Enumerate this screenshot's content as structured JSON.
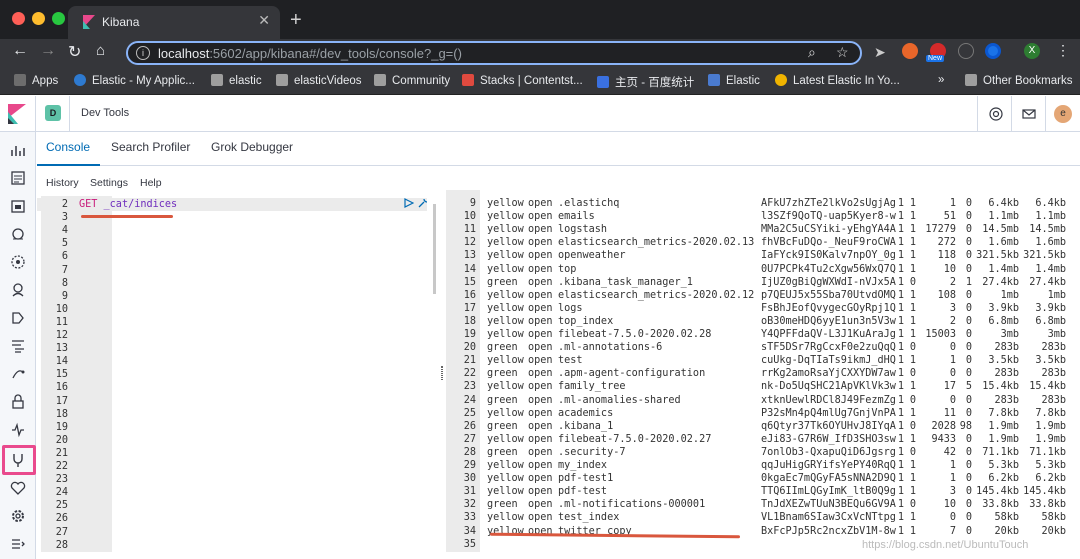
{
  "browser": {
    "tab_title": "Kibana",
    "url_host": "localhost",
    "url_rest": ":5602/app/kibana#/dev_tools/console?_g=()",
    "new_badge": "New",
    "account_initial": "X",
    "bookmarks": [
      {
        "label": "Apps",
        "color": "#6d6d6d"
      },
      {
        "label": "Elastic - My Applic...",
        "color": "#2e7ad0"
      },
      {
        "label": "elastic",
        "color": "#9e9e9e"
      },
      {
        "label": "elasticVideos",
        "color": "#9e9e9e"
      },
      {
        "label": "Community",
        "color": "#9e9e9e"
      },
      {
        "label": "Stacks | Contentst...",
        "color": "#e04a3f"
      },
      {
        "label": "主页 - 百度统计",
        "color": "#3a70e0"
      },
      {
        "label": "Elastic",
        "color": "#4a7bd0"
      },
      {
        "label": "Latest Elastic In Yo...",
        "color": "#f0b400"
      }
    ],
    "more_bookmarks": "»",
    "other_bookmarks": "Other Bookmarks"
  },
  "header": {
    "space_initial": "D",
    "breadcrumb": "Dev Tools",
    "user_initial": "e"
  },
  "tabs": [
    "Console",
    "Search Profiler",
    "Grok Debugger"
  ],
  "menu": [
    "History",
    "Settings",
    "Help"
  ],
  "editor": {
    "lines": [
      {
        "num": "2",
        "method": "GET",
        "path": " _cat/indices"
      },
      {
        "num": "3",
        "method": "",
        "path": ""
      },
      {
        "num": "4",
        "method": "",
        "path": ""
      },
      {
        "num": "5",
        "method": "",
        "path": ""
      },
      {
        "num": "6",
        "method": "",
        "path": ""
      },
      {
        "num": "7",
        "method": "",
        "path": ""
      },
      {
        "num": "8",
        "method": "",
        "path": ""
      },
      {
        "num": "9",
        "method": "",
        "path": ""
      },
      {
        "num": "10",
        "method": "",
        "path": ""
      },
      {
        "num": "11",
        "method": "",
        "path": ""
      },
      {
        "num": "12",
        "method": "",
        "path": ""
      },
      {
        "num": "13",
        "method": "",
        "path": ""
      },
      {
        "num": "14",
        "method": "",
        "path": ""
      },
      {
        "num": "15",
        "method": "",
        "path": ""
      },
      {
        "num": "16",
        "method": "",
        "path": ""
      },
      {
        "num": "17",
        "method": "",
        "path": ""
      },
      {
        "num": "18",
        "method": "",
        "path": ""
      },
      {
        "num": "19",
        "method": "",
        "path": ""
      },
      {
        "num": "20",
        "method": "",
        "path": ""
      },
      {
        "num": "21",
        "method": "",
        "path": ""
      },
      {
        "num": "22",
        "method": "",
        "path": ""
      },
      {
        "num": "23",
        "method": "",
        "path": ""
      },
      {
        "num": "24",
        "method": "",
        "path": ""
      },
      {
        "num": "25",
        "method": "",
        "path": ""
      },
      {
        "num": "26",
        "method": "",
        "path": ""
      },
      {
        "num": "27",
        "method": "",
        "path": ""
      },
      {
        "num": "28",
        "method": "",
        "path": ""
      }
    ]
  },
  "output": {
    "rows": [
      {
        "num": "9",
        "health": "yellow",
        "status": "open",
        "index": ".elastichq",
        "uuid": "AFkU7zhZTe2lkVo2sUgjAg",
        "pri": "1",
        "rep": "1",
        "docs": "1",
        "del": "0",
        "size": "6.4kb",
        "psize": "6.4kb"
      },
      {
        "num": "10",
        "health": "yellow",
        "status": "open",
        "index": "emails",
        "uuid": "l3SZf9QoTQ-uap5Kyer8-w",
        "pri": "1",
        "rep": "1",
        "docs": "51",
        "del": "0",
        "size": "1.1mb",
        "psize": "1.1mb"
      },
      {
        "num": "11",
        "health": "yellow",
        "status": "open",
        "index": "logstash",
        "uuid": "MMa2C5uCSYiki-yEhgYA4A",
        "pri": "1",
        "rep": "1",
        "docs": "17279",
        "del": "0",
        "size": "14.5mb",
        "psize": "14.5mb"
      },
      {
        "num": "12",
        "health": "yellow",
        "status": "open",
        "index": "elasticsearch_metrics-2020.02.13",
        "uuid": "fhVBcFuDQo-_NeuF9roCWA",
        "pri": "1",
        "rep": "1",
        "docs": "272",
        "del": "0",
        "size": "1.6mb",
        "psize": "1.6mb"
      },
      {
        "num": "13",
        "health": "yellow",
        "status": "open",
        "index": "openweather",
        "uuid": "IaFYck9IS0Kalv7npOY_0g",
        "pri": "1",
        "rep": "1",
        "docs": "118",
        "del": "0",
        "size": "321.5kb",
        "psize": "321.5kb"
      },
      {
        "num": "14",
        "health": "yellow",
        "status": "open",
        "index": "top",
        "uuid": "0U7PCPk4Tu2cXgw56WxQ7Q",
        "pri": "1",
        "rep": "1",
        "docs": "10",
        "del": "0",
        "size": "1.4mb",
        "psize": "1.4mb"
      },
      {
        "num": "15",
        "health": "green",
        "status": "open",
        "index": ".kibana_task_manager_1",
        "uuid": "IjUZ0gBiQgWXWdI-nVJx5A",
        "pri": "1",
        "rep": "0",
        "docs": "2",
        "del": "1",
        "size": "27.4kb",
        "psize": "27.4kb"
      },
      {
        "num": "16",
        "health": "yellow",
        "status": "open",
        "index": "elasticsearch_metrics-2020.02.12",
        "uuid": "p7QEUJ5x55Sba70UtvdOMQ",
        "pri": "1",
        "rep": "1",
        "docs": "108",
        "del": "0",
        "size": "1mb",
        "psize": "1mb"
      },
      {
        "num": "17",
        "health": "yellow",
        "status": "open",
        "index": "logs",
        "uuid": "FsBhJEofQvygecGOyRpj1Q",
        "pri": "1",
        "rep": "1",
        "docs": "3",
        "del": "0",
        "size": "3.9kb",
        "psize": "3.9kb"
      },
      {
        "num": "18",
        "health": "yellow",
        "status": "open",
        "index": "top_index",
        "uuid": "oB30meHDQ6yyE1un3n5V3w",
        "pri": "1",
        "rep": "1",
        "docs": "2",
        "del": "0",
        "size": "6.8mb",
        "psize": "6.8mb"
      },
      {
        "num": "19",
        "health": "yellow",
        "status": "open",
        "index": "filebeat-7.5.0-2020.02.28",
        "uuid": "Y4QPFFdaQV-L3J1KuAraJg",
        "pri": "1",
        "rep": "1",
        "docs": "15003",
        "del": "0",
        "size": "3mb",
        "psize": "3mb"
      },
      {
        "num": "20",
        "health": "green",
        "status": "open",
        "index": ".ml-annotations-6",
        "uuid": "sTF5DSr7RgCcxF0e2zuQqQ",
        "pri": "1",
        "rep": "0",
        "docs": "0",
        "del": "0",
        "size": "283b",
        "psize": "283b"
      },
      {
        "num": "21",
        "health": "yellow",
        "status": "open",
        "index": "test",
        "uuid": "cuUkg-DqTIaTs9ikmJ_dHQ",
        "pri": "1",
        "rep": "1",
        "docs": "1",
        "del": "0",
        "size": "3.5kb",
        "psize": "3.5kb"
      },
      {
        "num": "22",
        "health": "green",
        "status": "open",
        "index": ".apm-agent-configuration",
        "uuid": "rrKg2amoRsaYjCXXYDW7aw",
        "pri": "1",
        "rep": "0",
        "docs": "0",
        "del": "0",
        "size": "283b",
        "psize": "283b"
      },
      {
        "num": "23",
        "health": "yellow",
        "status": "open",
        "index": "family_tree",
        "uuid": "nk-Do5UqSHC21ApVKlVk3w",
        "pri": "1",
        "rep": "1",
        "docs": "17",
        "del": "5",
        "size": "15.4kb",
        "psize": "15.4kb"
      },
      {
        "num": "24",
        "health": "green",
        "status": "open",
        "index": ".ml-anomalies-shared",
        "uuid": "xtknUewlRDCl8J49FezmZg",
        "pri": "1",
        "rep": "0",
        "docs": "0",
        "del": "0",
        "size": "283b",
        "psize": "283b"
      },
      {
        "num": "25",
        "health": "yellow",
        "status": "open",
        "index": "academics",
        "uuid": "P32sMn4pQ4mlUg7GnjVnPA",
        "pri": "1",
        "rep": "1",
        "docs": "11",
        "del": "0",
        "size": "7.8kb",
        "psize": "7.8kb"
      },
      {
        "num": "26",
        "health": "green",
        "status": "open",
        "index": ".kibana_1",
        "uuid": "q6Qtyr37Tk6OYUHvJ8IYqA",
        "pri": "1",
        "rep": "0",
        "docs": "2028",
        "del": "98",
        "size": "1.9mb",
        "psize": "1.9mb"
      },
      {
        "num": "27",
        "health": "yellow",
        "status": "open",
        "index": "filebeat-7.5.0-2020.02.27",
        "uuid": "eJi83-G7R6W_IfD3SHO3sw",
        "pri": "1",
        "rep": "1",
        "docs": "9433",
        "del": "0",
        "size": "1.9mb",
        "psize": "1.9mb"
      },
      {
        "num": "28",
        "health": "green",
        "status": "open",
        "index": ".security-7",
        "uuid": "7onlOb3-QxapuQiD6Jgsrg",
        "pri": "1",
        "rep": "0",
        "docs": "42",
        "del": "0",
        "size": "71.1kb",
        "psize": "71.1kb"
      },
      {
        "num": "29",
        "health": "yellow",
        "status": "open",
        "index": "my_index",
        "uuid": "qqJuHigGRYifsYePY40RqQ",
        "pri": "1",
        "rep": "1",
        "docs": "1",
        "del": "0",
        "size": "5.3kb",
        "psize": "5.3kb"
      },
      {
        "num": "30",
        "health": "yellow",
        "status": "open",
        "index": "pdf-test1",
        "uuid": "0kgaEc7mQGyFA5sNNA2D9Q",
        "pri": "1",
        "rep": "1",
        "docs": "1",
        "del": "0",
        "size": "6.2kb",
        "psize": "6.2kb"
      },
      {
        "num": "31",
        "health": "yellow",
        "status": "open",
        "index": "pdf-test",
        "uuid": "TTQ6IImLQGyImK_ltB0Q9g",
        "pri": "1",
        "rep": "1",
        "docs": "3",
        "del": "0",
        "size": "145.4kb",
        "psize": "145.4kb"
      },
      {
        "num": "32",
        "health": "green",
        "status": "open",
        "index": ".ml-notifications-000001",
        "uuid": "TnJdXEZwTUuN3BEQu6GV9A",
        "pri": "1",
        "rep": "0",
        "docs": "10",
        "del": "0",
        "size": "33.8kb",
        "psize": "33.8kb"
      },
      {
        "num": "33",
        "health": "yellow",
        "status": "open",
        "index": "test_index",
        "uuid": "VL1Bnam6SIaw3CxVcNTtpg",
        "pri": "1",
        "rep": "1",
        "docs": "0",
        "del": "0",
        "size": "58kb",
        "psize": "58kb"
      },
      {
        "num": "34",
        "health": "yellow",
        "status": "open",
        "index": "twitter_copy",
        "uuid": "BxFcPJp5Rc2ncxZbV1M-8w",
        "pri": "1",
        "rep": "1",
        "docs": "7",
        "del": "0",
        "size": "20kb",
        "psize": "20kb"
      },
      {
        "num": "35",
        "health": "",
        "status": "",
        "index": "",
        "uuid": "",
        "pri": "",
        "rep": "",
        "docs": "",
        "del": "",
        "size": "",
        "psize": ""
      }
    ]
  },
  "watermark": "https://blog.csdn.net/UbuntuTouch",
  "colors": {
    "accent": "#006bb4",
    "highlight": "#e94a8d",
    "annotation": "#d9573d"
  }
}
